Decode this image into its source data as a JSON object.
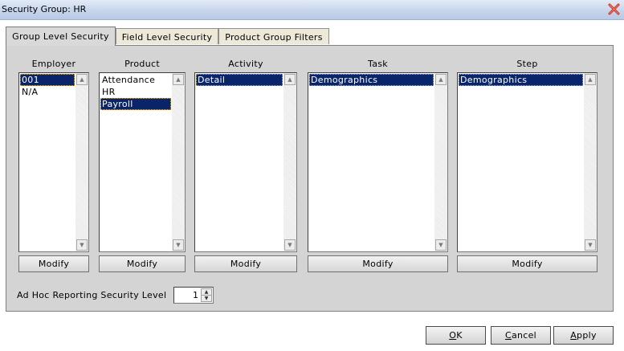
{
  "window": {
    "title": "Security Group: HR",
    "close_icon": "close-icon"
  },
  "tabs": [
    {
      "label": "Group Level Security",
      "active": true
    },
    {
      "label": "Field Level Security",
      "active": false
    },
    {
      "label": "Product Group Filters",
      "active": false
    }
  ],
  "columns": [
    {
      "label": "Employer",
      "items": [
        "001",
        "N/A"
      ],
      "selected": "001",
      "button": "Modify"
    },
    {
      "label": "Product",
      "items": [
        "Attendance",
        "HR",
        "Payroll"
      ],
      "selected": "Payroll",
      "button": "Modify"
    },
    {
      "label": "Activity",
      "items": [
        "Detail"
      ],
      "selected": "Detail",
      "button": "Modify"
    },
    {
      "label": "Task",
      "items": [
        "Demographics"
      ],
      "selected": "Demographics",
      "button": "Modify"
    },
    {
      "label": "Step",
      "items": [
        "Demographics"
      ],
      "selected": "Demographics",
      "button": "Modify"
    }
  ],
  "adhoc": {
    "label": "Ad Hoc Reporting Security Level",
    "value": "1"
  },
  "buttons": {
    "ok": {
      "accel": "O",
      "rest": "K"
    },
    "cancel": {
      "accel": "C",
      "rest": "ancel"
    },
    "apply": {
      "accel": "A",
      "rest": "pply"
    }
  },
  "colors": {
    "selection": "#0a246a",
    "panel": "#d4d4d4",
    "titlebar": "#c7d5ec",
    "close": "#d03020"
  }
}
